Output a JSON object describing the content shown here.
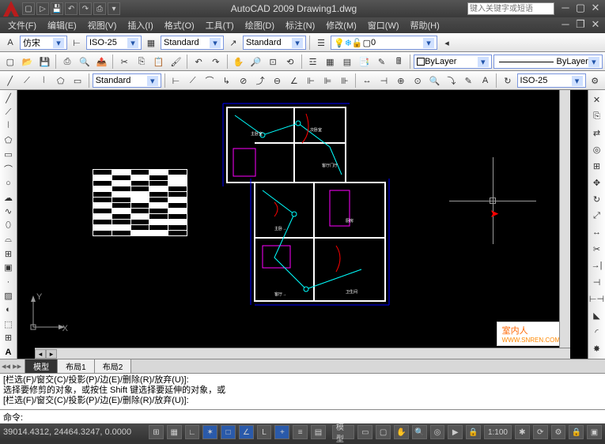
{
  "title": "AutoCAD 2009  Drawing1.dwg",
  "search_placeholder": "键入关键字或短语",
  "menu": [
    "文件(F)",
    "编辑(E)",
    "视图(V)",
    "插入(I)",
    "格式(O)",
    "工具(T)",
    "绘图(D)",
    "标注(N)",
    "修改(M)",
    "窗口(W)",
    "帮助(H)"
  ],
  "styles": {
    "font": "仿宋",
    "dimstyle": "ISO-25",
    "textstyle": "Standard",
    "tablestyle": "Standard",
    "mlstyle": "Standard",
    "layer_color": "ByLayer",
    "linetype": "ByLayer",
    "dimstyle2": "ISO-25"
  },
  "tabs": {
    "model": "模型",
    "layout1": "布局1",
    "layout2": "布局2"
  },
  "cmd_history": [
    "[栏选(F)/窗交(C)/投影(P)/边(E)/删除(R)/放弃(U)]:",
    "选择要修剪的对象，或按住 Shift 键选择要延伸的对象，或",
    "[栏选(F)/窗交(C)/投影(P)/边(E)/删除(R)/放弃(U)]:"
  ],
  "cmd_prompt": "命令:",
  "coords": "39014.4312, 24464.3247, 0.0000",
  "status_right": {
    "space": "模型",
    "scale": "1:100"
  },
  "watermark": {
    "big": "室内人",
    "small": "WWW.SNREN.COM"
  },
  "ucs": {
    "x": "X",
    "y": "Y"
  },
  "layer_state": "0"
}
